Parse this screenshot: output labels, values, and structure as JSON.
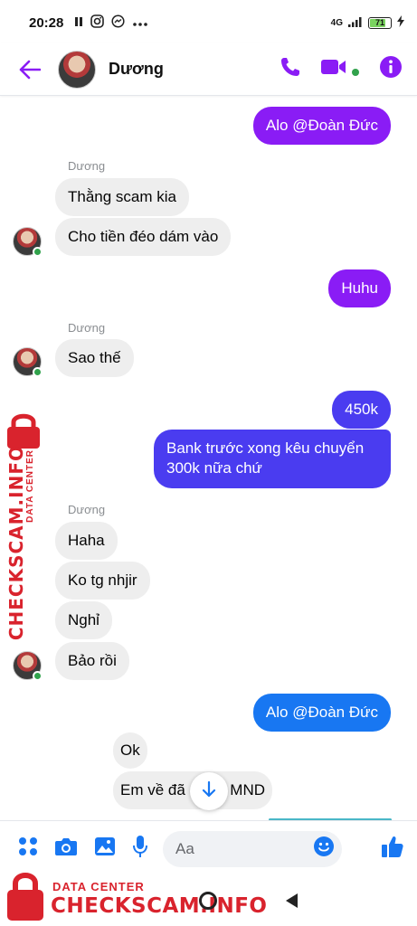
{
  "status_bar": {
    "time": "20:28",
    "network": "4G",
    "battery": "71",
    "battery_level": 0.71
  },
  "header": {
    "contact_name": "Dương"
  },
  "chat": {
    "messages": [
      {
        "text": "Alo @Đoàn Đức"
      },
      {
        "sender": "Dương"
      },
      {
        "text": "Thằng scam kia"
      },
      {
        "text": "Cho tiền đéo dám vào"
      },
      {
        "text": "Huhu"
      },
      {
        "sender": "Dương"
      },
      {
        "text": "Sao thế"
      },
      {
        "text": "450k"
      },
      {
        "text_line1": "Bank trước xong kêu chuyển",
        "text_line2": "300k nữa chứ"
      },
      {
        "sender": "Dương"
      },
      {
        "text": "Haha"
      },
      {
        "text": "Ko tg nhjir"
      },
      {
        "text": "Nghỉ"
      },
      {
        "text": "Bảo rồi"
      },
      {
        "text": "Alo @Đoàn Đức"
      },
      {
        "text": "Ok"
      },
      {
        "text_before": "Em về đã",
        "text_after": "MND"
      }
    ]
  },
  "composer": {
    "placeholder": "Aa"
  },
  "watermark": {
    "small": "DATA CENTER",
    "big": "CHECKSCAM.INFO"
  },
  "colors": {
    "accent": "#8a1cf5",
    "outgoing_blue": "#4a3cf0",
    "mention_blue": "#1877f2",
    "incoming": "#eeeeee",
    "watermark": "#d9232d"
  }
}
